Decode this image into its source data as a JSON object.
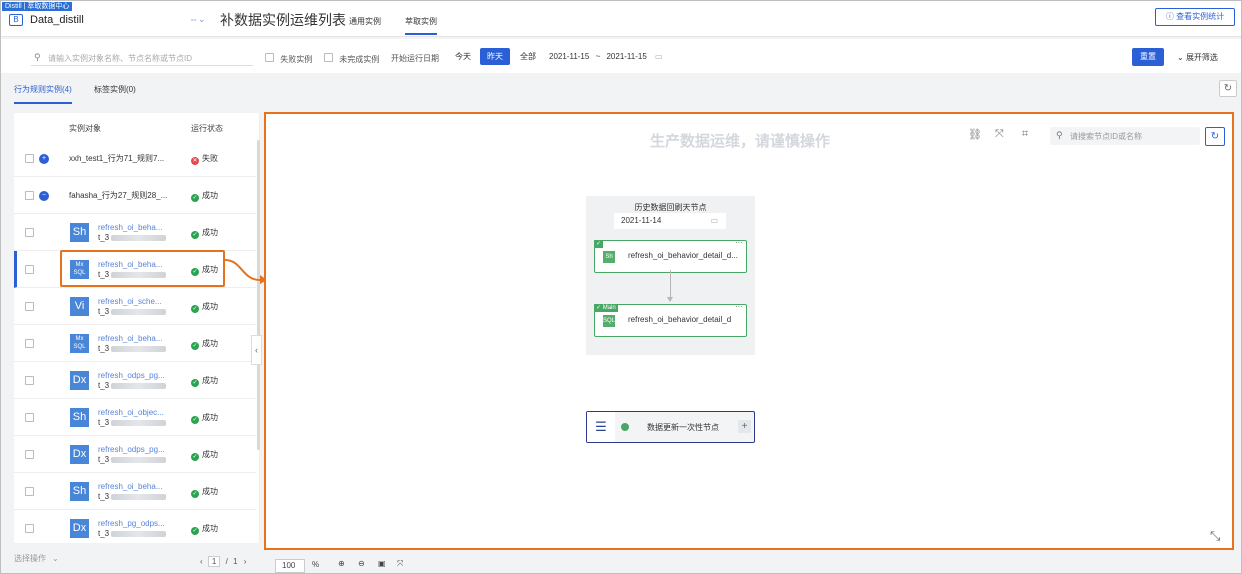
{
  "header": {
    "brand_badge": "Distill | 萃取数据中心",
    "workspace_icon": "B",
    "workspace_name": "Data_distill",
    "workspace_caret_icon": "swap-chevron-icon",
    "page_title": "补数据实例运维列表",
    "tabs": [
      {
        "label": "通用实例",
        "active": false
      },
      {
        "label": "萃取实例",
        "active": true
      }
    ],
    "stats_button": "查看实例统计"
  },
  "filters": {
    "search_placeholder": "请输入实例对象名称、节点名称或节点ID",
    "failed_only": "失败实例",
    "incomplete_only": "未完成实例",
    "start_date_label": "开始运行日期",
    "quick_dates": [
      {
        "label": "今天",
        "active": false
      },
      {
        "label": "昨天",
        "active": true
      },
      {
        "label": "全部",
        "active": false
      }
    ],
    "range_start": "2021-11-15",
    "range_sep": "~",
    "range_end": "2021-11-15",
    "reset_button": "重置",
    "expand_button": "展开筛选"
  },
  "subtabs": [
    {
      "label": "行为规则实例(4)",
      "active": true
    },
    {
      "label": "标签实例(0)",
      "active": false
    }
  ],
  "list": {
    "col_object": "实例对象",
    "col_status": "运行状态",
    "rows": [
      {
        "type": "parent",
        "name": "xxh_test1_行为71_规则7...",
        "status": "失败",
        "ok": false,
        "expanded": false
      },
      {
        "type": "parent",
        "name": "fahasha_行为27_规则28_...",
        "status": "成功",
        "ok": true,
        "expanded": true
      },
      {
        "type": "child",
        "icon": "Sh",
        "link": "refresh_oi_beha...",
        "sub": "t_3",
        "status": "成功",
        "ok": true
      },
      {
        "type": "child",
        "icon": "MxSQL",
        "link": "refresh_oi_beha...",
        "sub": "t_3",
        "status": "成功",
        "ok": true,
        "selected": true
      },
      {
        "type": "child",
        "icon": "Vi",
        "link": "refresh_oi_sche...",
        "sub": "t_3",
        "status": "成功",
        "ok": true
      },
      {
        "type": "child",
        "icon": "MxSQL",
        "link": "refresh_oi_beha...",
        "sub": "t_3",
        "status": "成功",
        "ok": true
      },
      {
        "type": "child",
        "icon": "Dx",
        "link": "refresh_odps_pg...",
        "sub": "t_3",
        "status": "成功",
        "ok": true
      },
      {
        "type": "child",
        "icon": "Sh",
        "link": "refresh_oi_objec...",
        "sub": "t_3",
        "status": "成功",
        "ok": true
      },
      {
        "type": "child",
        "icon": "Dx",
        "link": "refresh_odps_pg...",
        "sub": "t_3",
        "status": "成功",
        "ok": true
      },
      {
        "type": "child",
        "icon": "Sh",
        "link": "refresh_oi_beha...",
        "sub": "t_3",
        "status": "成功",
        "ok": true
      },
      {
        "type": "child",
        "icon": "Dx",
        "link": "refresh_pg_odps...",
        "sub": "t_3",
        "status": "成功",
        "ok": true
      }
    ]
  },
  "footer": {
    "batch_select": "选择操作",
    "page_current": "1",
    "page_total": "1",
    "zoom_value": "100",
    "zoom_unit": "%"
  },
  "canvas": {
    "watermark": "生产数据运维，请谨慎操作",
    "search_placeholder": "请搜索节点ID或名称",
    "group_title": "历史数据回刷天节点",
    "group_date": "2021-11-14",
    "node1_label": "refresh_oi_behavior_detail_d...",
    "node1_icon": "Sh",
    "node2_tag": "Main",
    "node2_label": "refresh_oi_behavior_detail_d",
    "onetime_label": "数据更新一次性节点"
  },
  "colors": {
    "accent": "#2b5fd6",
    "callout": "#e8711c",
    "success": "#2aa44f",
    "fail": "#e5484d"
  }
}
